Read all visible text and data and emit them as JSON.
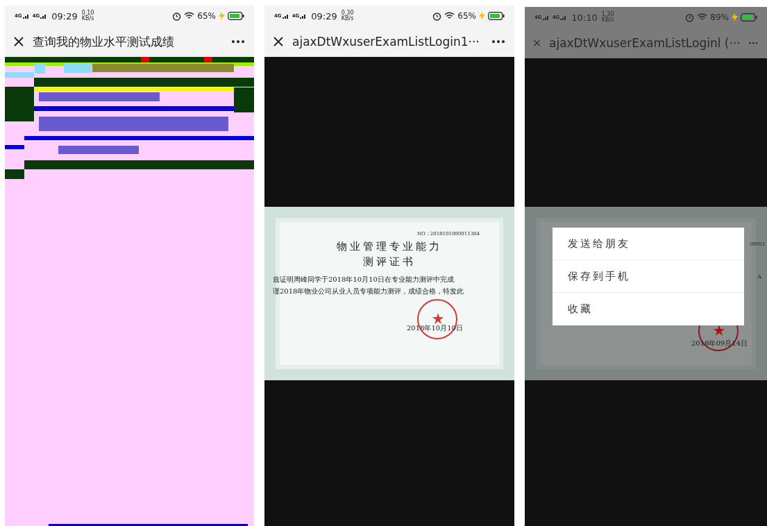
{
  "panels": [
    {
      "kind": "glitch",
      "dimmed": false,
      "status_bar": {
        "networks": [
          "4G",
          "4G"
        ],
        "time": "09:29",
        "speed": "0.10",
        "speed_unit": "KB/s",
        "battery": "65%"
      },
      "title": "查询我的物业水平测试成绩"
    },
    {
      "kind": "certificate",
      "dimmed": false,
      "status_bar": {
        "networks": [
          "4G",
          "4G"
        ],
        "time": "09:29",
        "speed": "0.30",
        "speed_unit": "KB/s",
        "battery": "65%"
      },
      "title": "ajaxDtWxuserExamListLogin1···",
      "certificate": {
        "number": "NO：2018101000011304",
        "heading": [
          "物业管理专业能力",
          "测评证书"
        ],
        "body": [
          "兹证明周峰同学于2018年10月10日在专业能力测评中完成",
          "谨2018年物业公司从业人员专项能力测评，成绩合格，特发此"
        ],
        "date": "2018年10月10日"
      }
    },
    {
      "kind": "menu",
      "dimmed": true,
      "status_bar": {
        "networks": [
          "4G",
          "4G"
        ],
        "time": "10:10",
        "speed": "1.30",
        "speed_unit": "KB/s",
        "battery": "89%"
      },
      "title": "ajaxDtWxuserExamListLoginl (···",
      "certificate": {
        "number_fragment": "09951",
        "text_fragment": "A",
        "date": "2018年09月14日"
      },
      "menu": [
        "发送给朋友",
        "保存到手机",
        "收藏"
      ]
    }
  ]
}
